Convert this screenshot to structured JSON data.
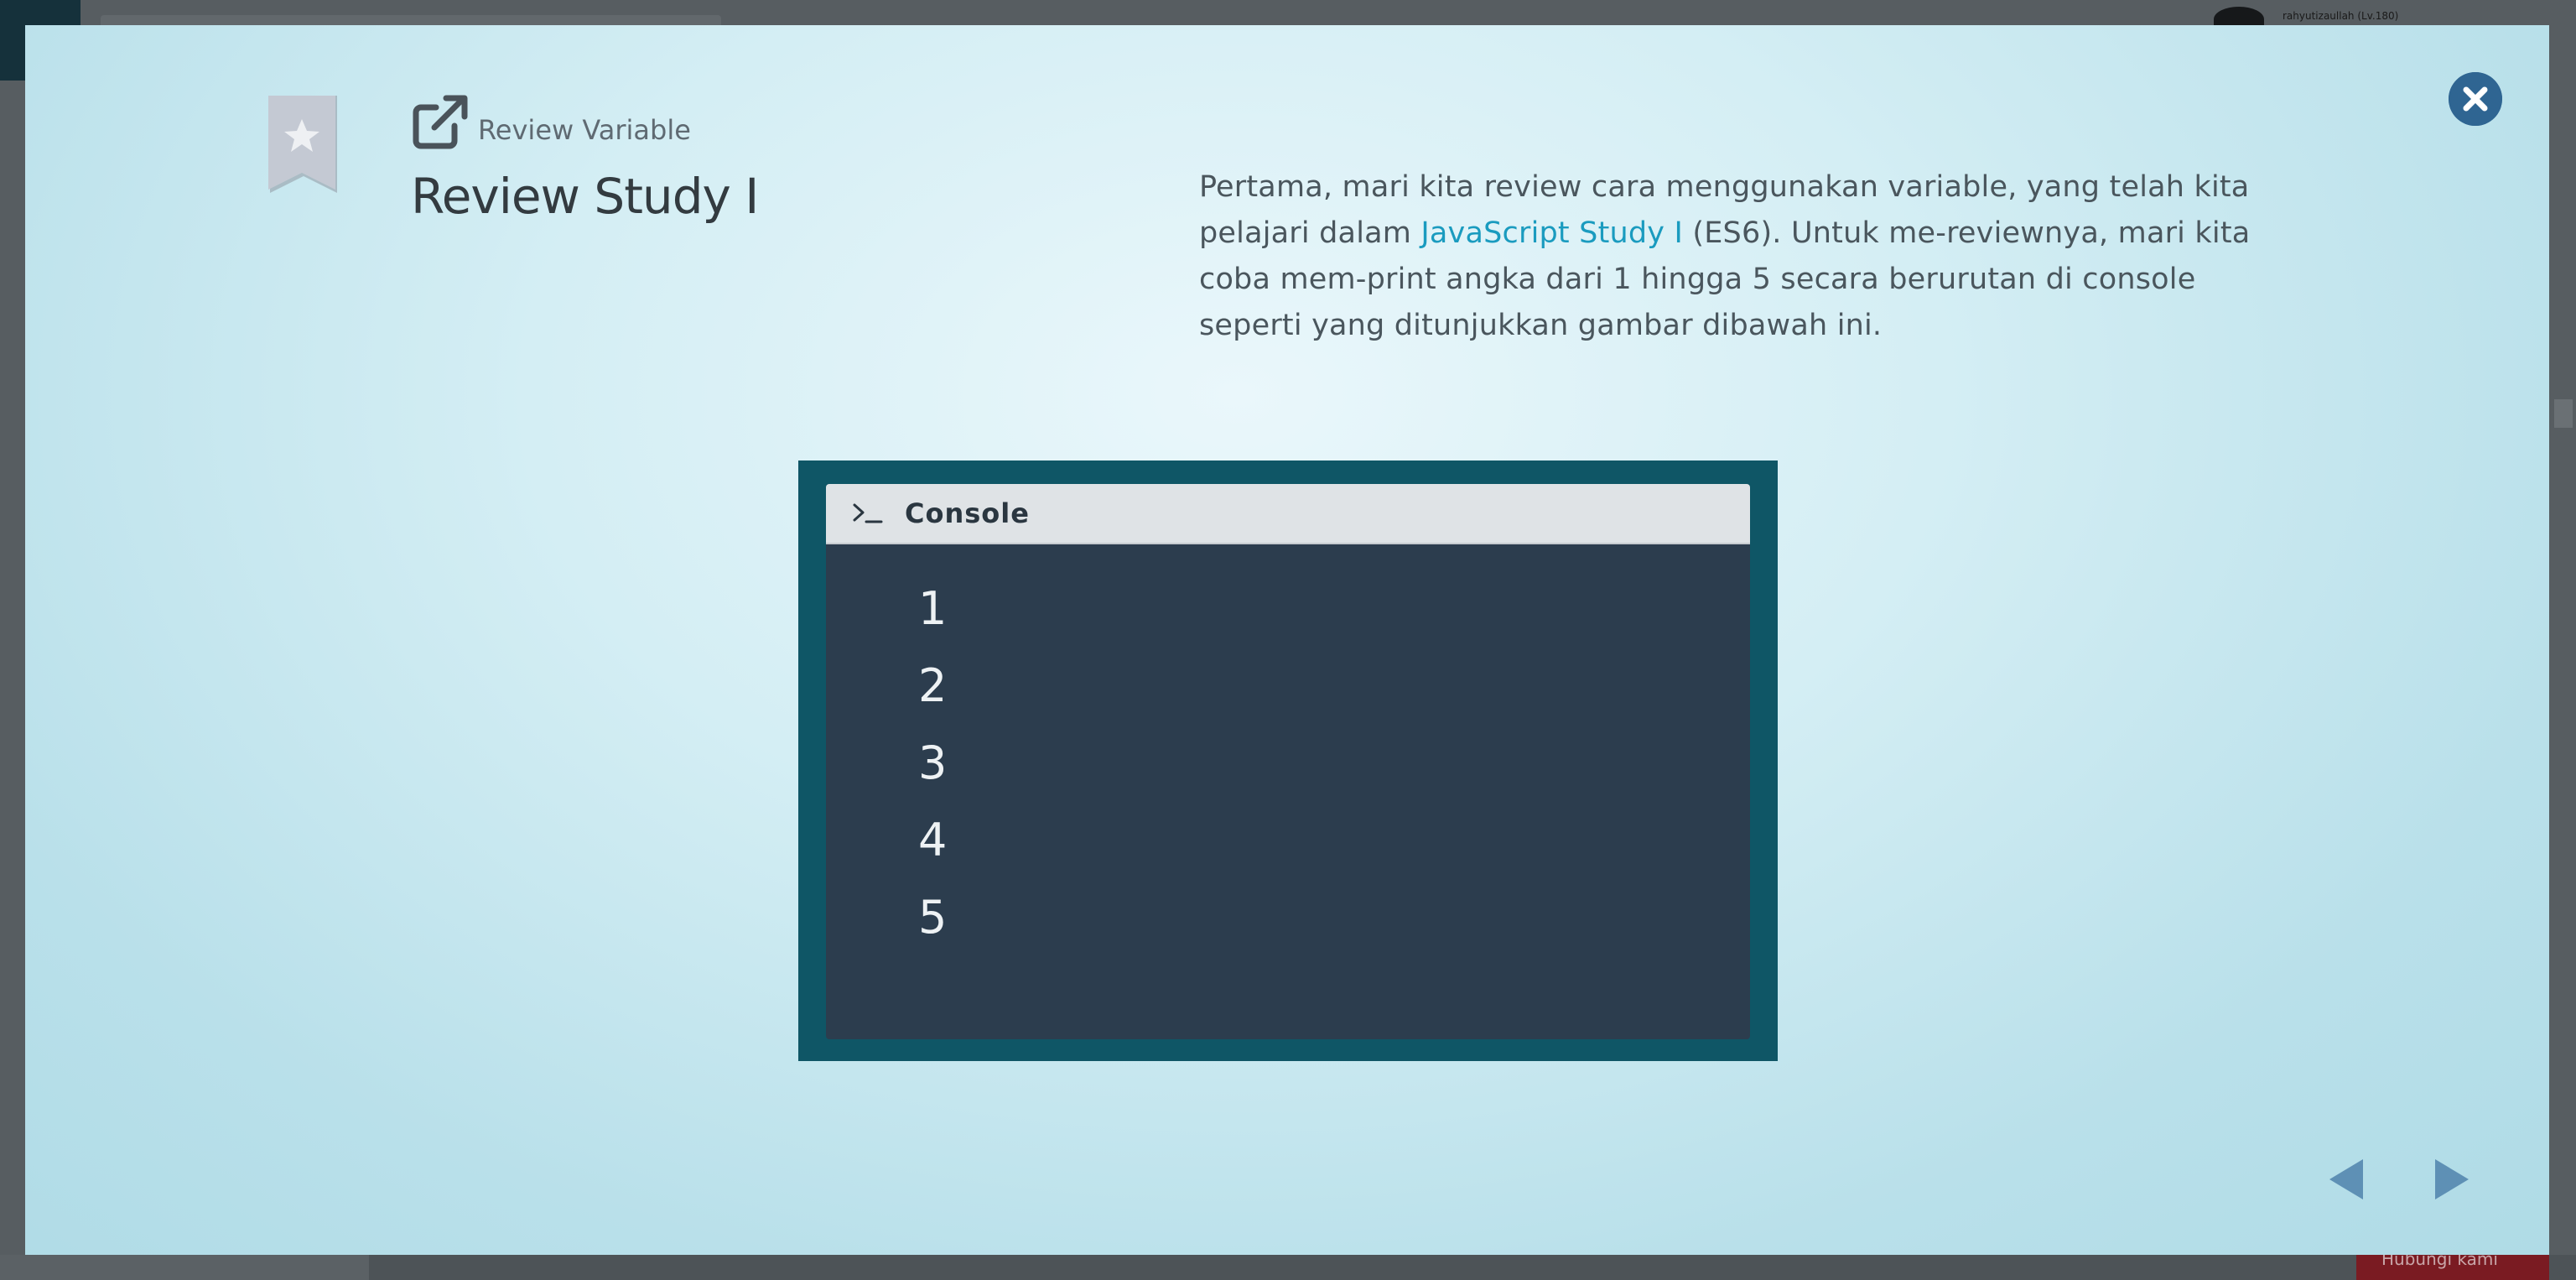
{
  "background": {
    "user_label": "rahyutizaullah (Lv.180)",
    "bottom_button_label": "Hubungi kami"
  },
  "modal": {
    "breadcrumb_label": "Review Variable",
    "title": "Review Study I",
    "description": {
      "part1": "Pertama, mari kita review cara menggunakan variable, yang telah kita pelajari dalam ",
      "link_text": "JavaScript Study I",
      "part2": " (ES6). Untuk me-reviewnya, mari kita coba mem-print angka dari 1 hingga 5 secara berurutan di console seperti yang ditunjukkan gambar dibawah ini."
    },
    "console": {
      "title": "Console",
      "lines": [
        "1",
        "2",
        "3",
        "4",
        "5"
      ]
    },
    "colors": {
      "accent": "#2f6592",
      "link": "#1a9bbf",
      "console_frame": "#0f5666",
      "console_bg": "#2c3d4e"
    },
    "icons": {
      "bookmark": "bookmark-star-icon",
      "external_link": "external-link-icon",
      "close": "close-icon",
      "prompt": "terminal-prompt-icon",
      "prev": "arrow-left-icon",
      "next": "arrow-right-icon"
    }
  }
}
